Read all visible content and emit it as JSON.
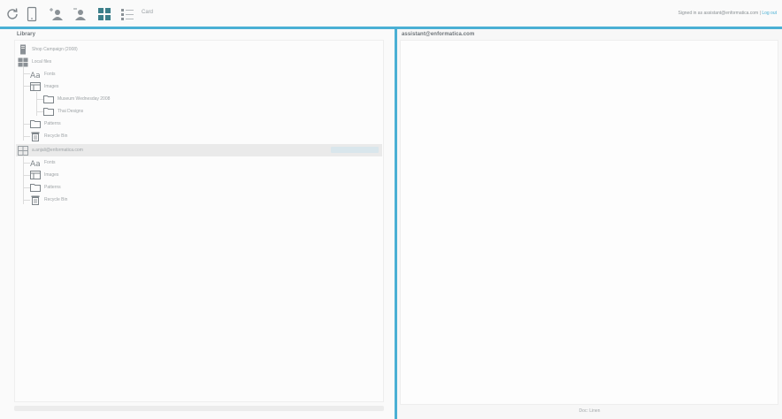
{
  "toolbar": {
    "mode_label": "Card",
    "user_text": "Signed in as assistant@enformatica.com | ",
    "logout_label": "Log out",
    "accent": "#4ab0d4",
    "icons": [
      "refresh-icon",
      "mobile-icon",
      "user-add-icon",
      "user-icon",
      "grid-view-icon",
      "list-view-icon"
    ]
  },
  "library": {
    "title": "Library",
    "items": [
      {
        "label": "Shop Campaign (2008)",
        "icon": "server-icon"
      },
      {
        "label": "Local files",
        "icon": "database-icon"
      },
      {
        "label": "Fonts",
        "icon": "font-icon"
      },
      {
        "label": "Images",
        "icon": "image-icon"
      },
      {
        "label": "Museum Wednesday 2008",
        "icon": "folder-icon"
      },
      {
        "label": "Thai Designs",
        "icon": "folder-icon"
      },
      {
        "label": "Patterns",
        "icon": "folder-icon"
      },
      {
        "label": "Recycle Bin",
        "icon": "trash-icon"
      },
      {
        "label": "a.anjali@enformatica.com",
        "icon": "database-icon"
      },
      {
        "label": "Fonts",
        "icon": "font-icon"
      },
      {
        "label": "Images",
        "icon": "image-icon"
      },
      {
        "label": "Patterns",
        "icon": "folder-icon"
      },
      {
        "label": "Recycle Bin",
        "icon": "trash-icon"
      }
    ]
  },
  "document": {
    "title": "assistant@enformatica.com",
    "footer": "Doc: Linen"
  }
}
